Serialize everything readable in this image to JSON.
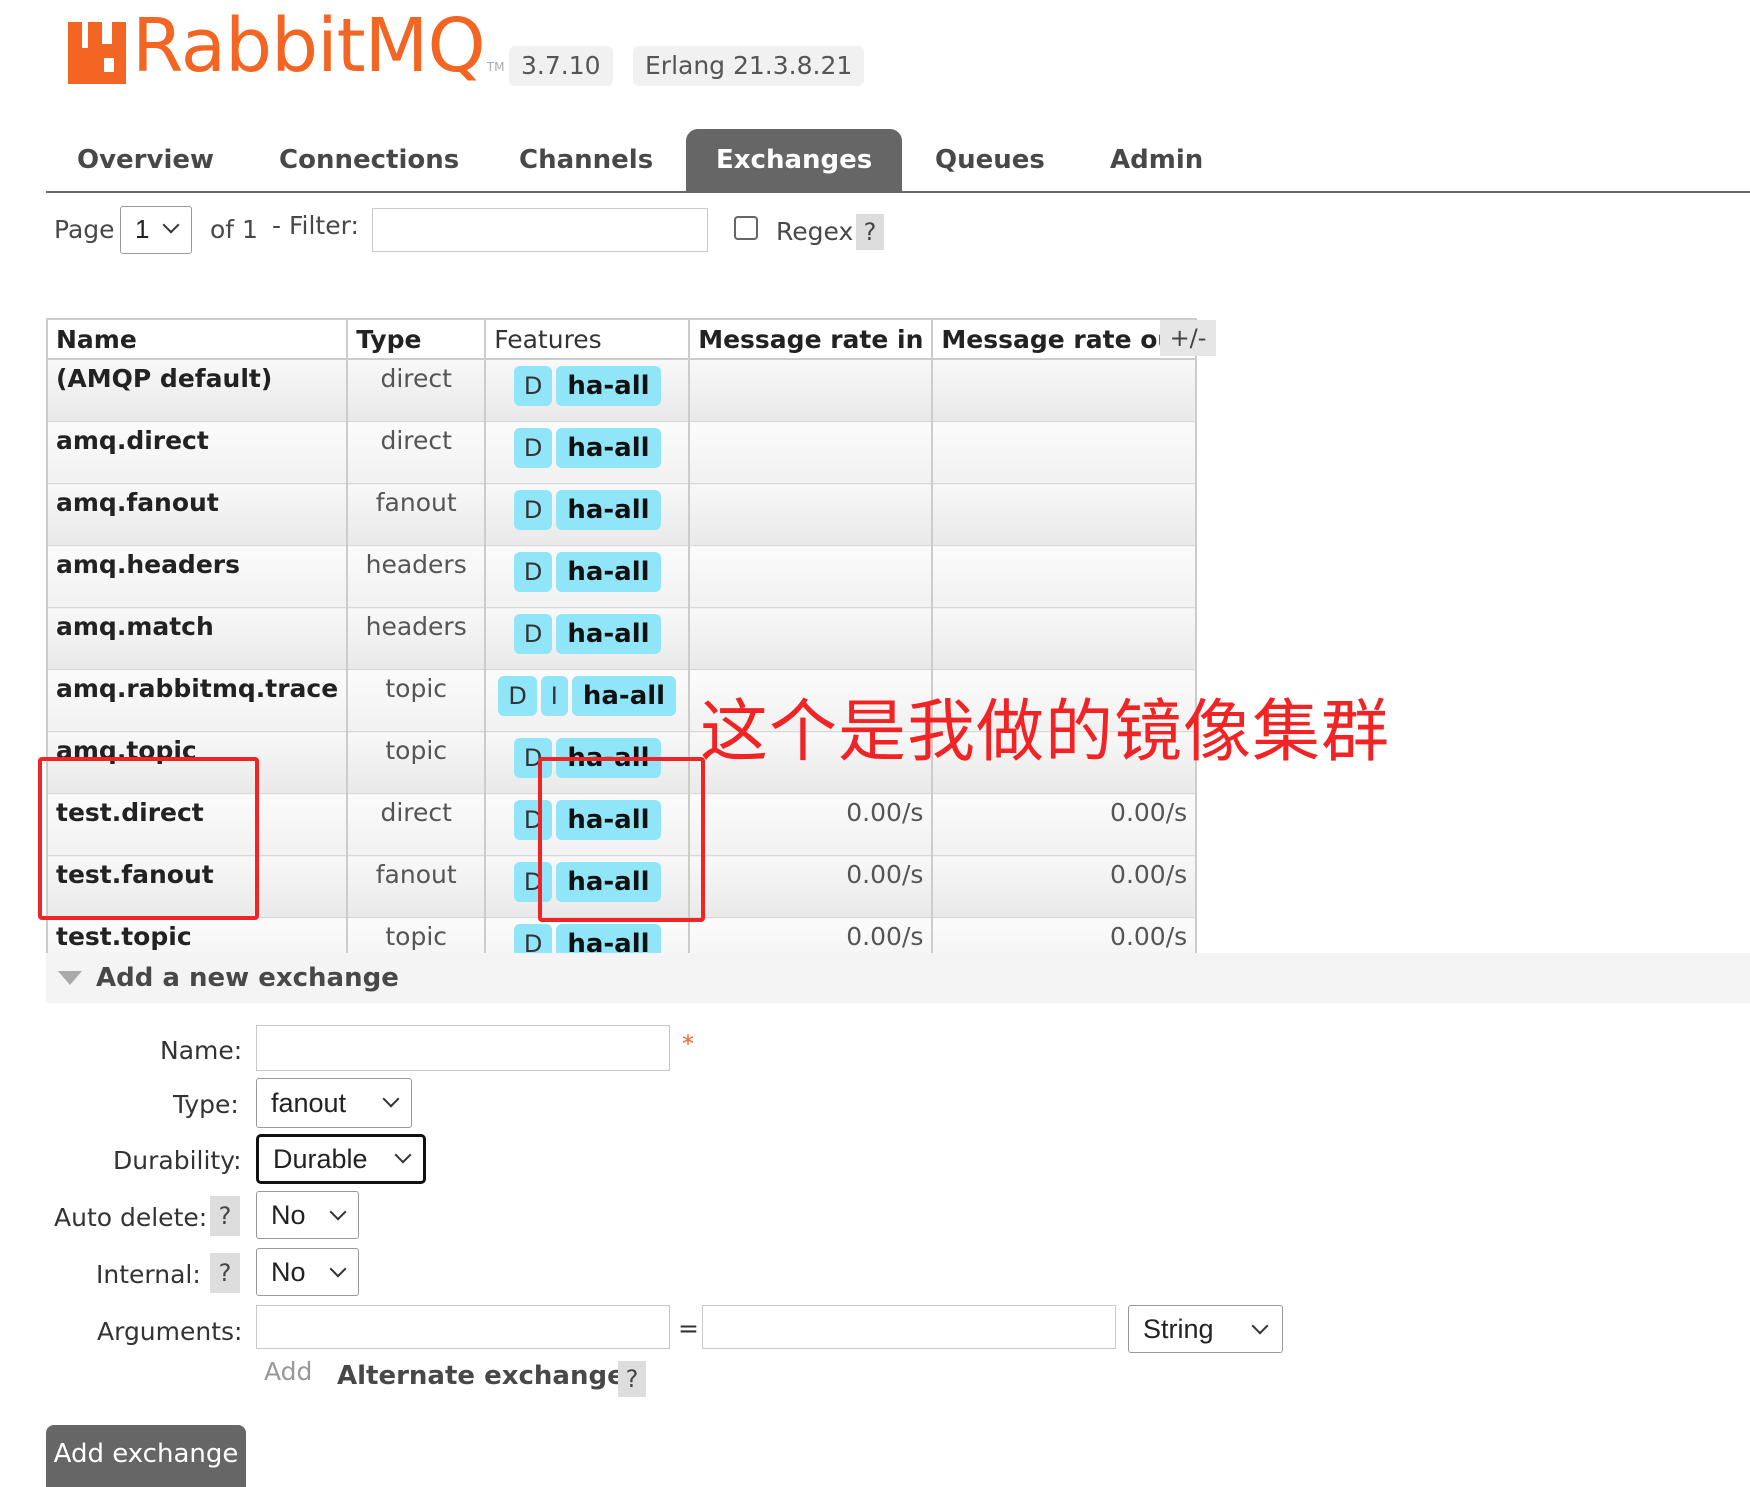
{
  "header": {
    "brand": "RabbitMQ",
    "trademark": "TM",
    "version": "3.7.10",
    "erlang": "Erlang 21.3.8.21",
    "brand_color": "#f26522"
  },
  "tabs": [
    {
      "label": "Overview",
      "active": false
    },
    {
      "label": "Connections",
      "active": false
    },
    {
      "label": "Channels",
      "active": false
    },
    {
      "label": "Exchanges",
      "active": true
    },
    {
      "label": "Queues",
      "active": false
    },
    {
      "label": "Admin",
      "active": false
    }
  ],
  "paging": {
    "page_label": "Page",
    "page_value": "1",
    "of_label": "of 1",
    "filter_label": "- Filter:",
    "filter_value": "",
    "regex_label": "Regex",
    "regex_checked": false,
    "help": "?"
  },
  "table": {
    "columns": [
      "Name",
      "Type",
      "Features",
      "Message rate in",
      "Message rate out"
    ],
    "plus_minus": "+/-",
    "rows": [
      {
        "name": "(AMQP default)",
        "type": "direct",
        "features": [
          "D"
        ],
        "policy": "ha-all",
        "rate_in": "",
        "rate_out": ""
      },
      {
        "name": "amq.direct",
        "type": "direct",
        "features": [
          "D"
        ],
        "policy": "ha-all",
        "rate_in": "",
        "rate_out": ""
      },
      {
        "name": "amq.fanout",
        "type": "fanout",
        "features": [
          "D"
        ],
        "policy": "ha-all",
        "rate_in": "",
        "rate_out": ""
      },
      {
        "name": "amq.headers",
        "type": "headers",
        "features": [
          "D"
        ],
        "policy": "ha-all",
        "rate_in": "",
        "rate_out": ""
      },
      {
        "name": "amq.match",
        "type": "headers",
        "features": [
          "D"
        ],
        "policy": "ha-all",
        "rate_in": "",
        "rate_out": ""
      },
      {
        "name": "amq.rabbitmq.trace",
        "type": "topic",
        "features": [
          "D",
          "I"
        ],
        "policy": "ha-all",
        "rate_in": "",
        "rate_out": ""
      },
      {
        "name": "amq.topic",
        "type": "topic",
        "features": [
          "D"
        ],
        "policy": "ha-all",
        "rate_in": "",
        "rate_out": ""
      },
      {
        "name": "test.direct",
        "type": "direct",
        "features": [
          "D"
        ],
        "policy": "ha-all",
        "rate_in": "0.00/s",
        "rate_out": "0.00/s"
      },
      {
        "name": "test.fanout",
        "type": "fanout",
        "features": [
          "D"
        ],
        "policy": "ha-all",
        "rate_in": "0.00/s",
        "rate_out": "0.00/s"
      },
      {
        "name": "test.topic",
        "type": "topic",
        "features": [
          "D"
        ],
        "policy": "ha-all",
        "rate_in": "0.00/s",
        "rate_out": "0.00/s"
      }
    ],
    "tag_color": "#90e5f8"
  },
  "annotation": {
    "text": "这个是我做的镜像集群",
    "color": "#f02424"
  },
  "add_exchange": {
    "section_title": "Add a new exchange",
    "name_label": "Name:",
    "name_value": "",
    "required_mark": "*",
    "type_label": "Type:",
    "type_value": "fanout",
    "durability_label": "Durability:",
    "durability_value": "Durable",
    "auto_delete_label": "Auto delete:",
    "auto_delete_value": "No",
    "internal_label": "Internal:",
    "internal_value": "No",
    "arguments_label": "Arguments:",
    "arguments_key": "",
    "arguments_equals": "=",
    "arguments_value": "",
    "arguments_type": "String",
    "add_link": "Add",
    "alternate_exchange": "Alternate exchange",
    "help": "?",
    "submit": "Add exchange"
  }
}
